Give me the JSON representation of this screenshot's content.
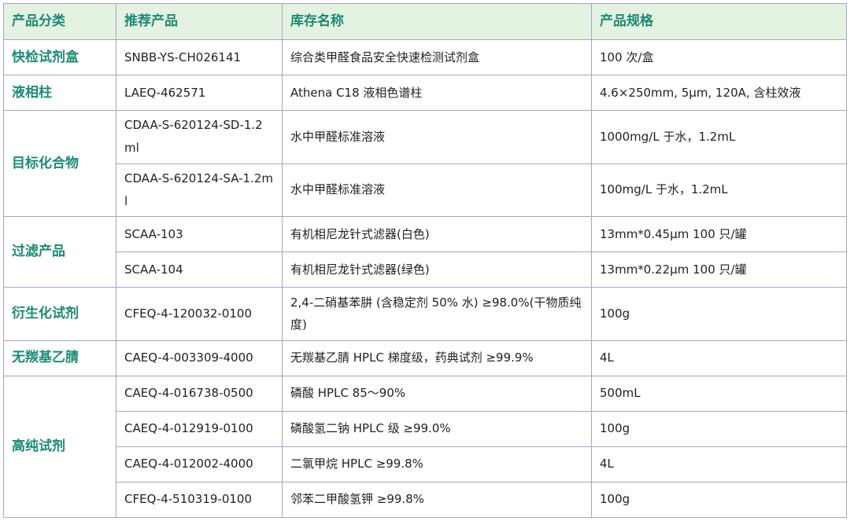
{
  "headers": [
    "产品分类",
    "推荐产品",
    "库存名称",
    "产品规格"
  ],
  "rows": [
    {
      "category": "快检试剂盒",
      "code": "SNBB-YS-CH026141",
      "name": "综合类甲醛食品安全快速检测试剂盒",
      "spec": "100 次/盒"
    },
    {
      "category": "液相柱",
      "code": "LAEQ-462571",
      "name": "Athena C18  液相色谱柱",
      "spec": "4.6×250mm, 5μm, 120A, 含柱效液"
    },
    {
      "category": "目标化合物",
      "code": "CDAA-S-620124-SD-1.2ml",
      "name": "水中甲醛标准溶液",
      "spec": "1000mg/L 于水，1.2mL"
    },
    {
      "category": "",
      "code": "CDAA-S-620124-SA-1.2ml",
      "name": "水中甲醛标准溶液",
      "spec": "100mg/L 于水，1.2mL"
    },
    {
      "category": "过滤产品",
      "code": "SCAA-103",
      "name": "有机相尼龙针式滤器(白色)",
      "spec": "13mm*0.45μm 100 只/罐"
    },
    {
      "category": "",
      "code": "SCAA-104",
      "name": "有机相尼龙针式滤器(绿色)",
      "spec": "13mm*0.22μm 100 只/罐"
    },
    {
      "category": "衍生化试剂",
      "code": "CFEQ-4-120032-0100",
      "name": "2,4-二硝基苯肼 (含稳定剂 50%  水) ≥98.0%(干物质纯度)",
      "spec": "100g"
    },
    {
      "category": "无羰基乙腈",
      "code": "CAEQ-4-003309-4000",
      "name": "无羰基乙腈  HPLC  梯度级，药典试剂  ≥99.9%",
      "spec": "4L"
    },
    {
      "category": "高纯试剂",
      "code": "CAEQ-4-016738-0500",
      "name": "磷酸  HPLC 85～90%",
      "spec": "500mL"
    },
    {
      "category": "",
      "code": "CAEQ-4-012919-0100",
      "name": "磷酸氢二钠  HPLC 级  ≥99.0%",
      "spec": "100g"
    },
    {
      "category": "",
      "code": "CAEQ-4-012002-4000",
      "name": "二氯甲烷  HPLC  ≥99.8%",
      "spec": "4L"
    },
    {
      "category": "",
      "code": "CFEQ-4-510319-0100",
      "name": "邻苯二甲酸氢钾  ≥99.8%",
      "spec": "100g"
    }
  ],
  "colors": {
    "header_bg": "#e3f2e1",
    "accent": "#1d8a76",
    "border": "#a9a3c9"
  }
}
